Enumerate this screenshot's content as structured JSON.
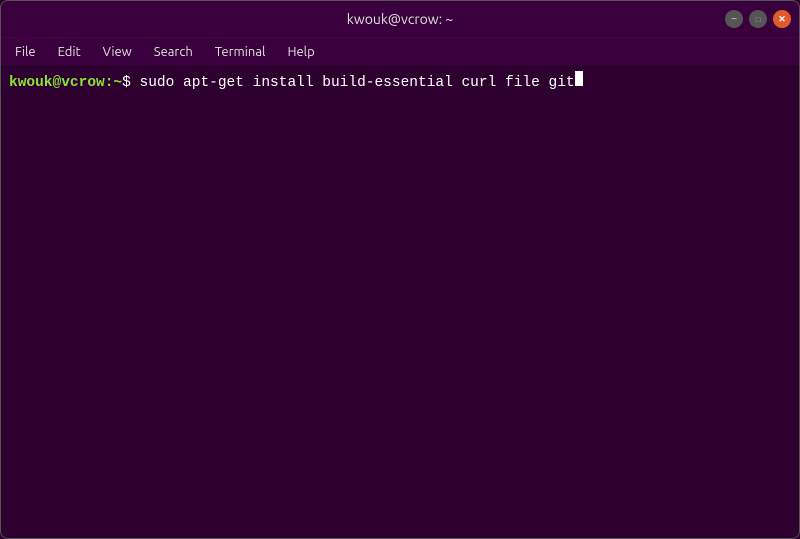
{
  "window": {
    "title": "kwouk@vcrow: ~",
    "controls": {
      "minimize_label": "−",
      "maximize_label": "□",
      "close_label": "✕"
    }
  },
  "menubar": {
    "items": [
      {
        "label": "File"
      },
      {
        "label": "Edit"
      },
      {
        "label": "View"
      },
      {
        "label": "Search"
      },
      {
        "label": "Terminal"
      },
      {
        "label": "Help"
      }
    ]
  },
  "terminal": {
    "prompt_user": "kwouk@vcrow:~",
    "prompt_symbol": "$",
    "command": " sudo apt-get install build-essential curl file git"
  }
}
